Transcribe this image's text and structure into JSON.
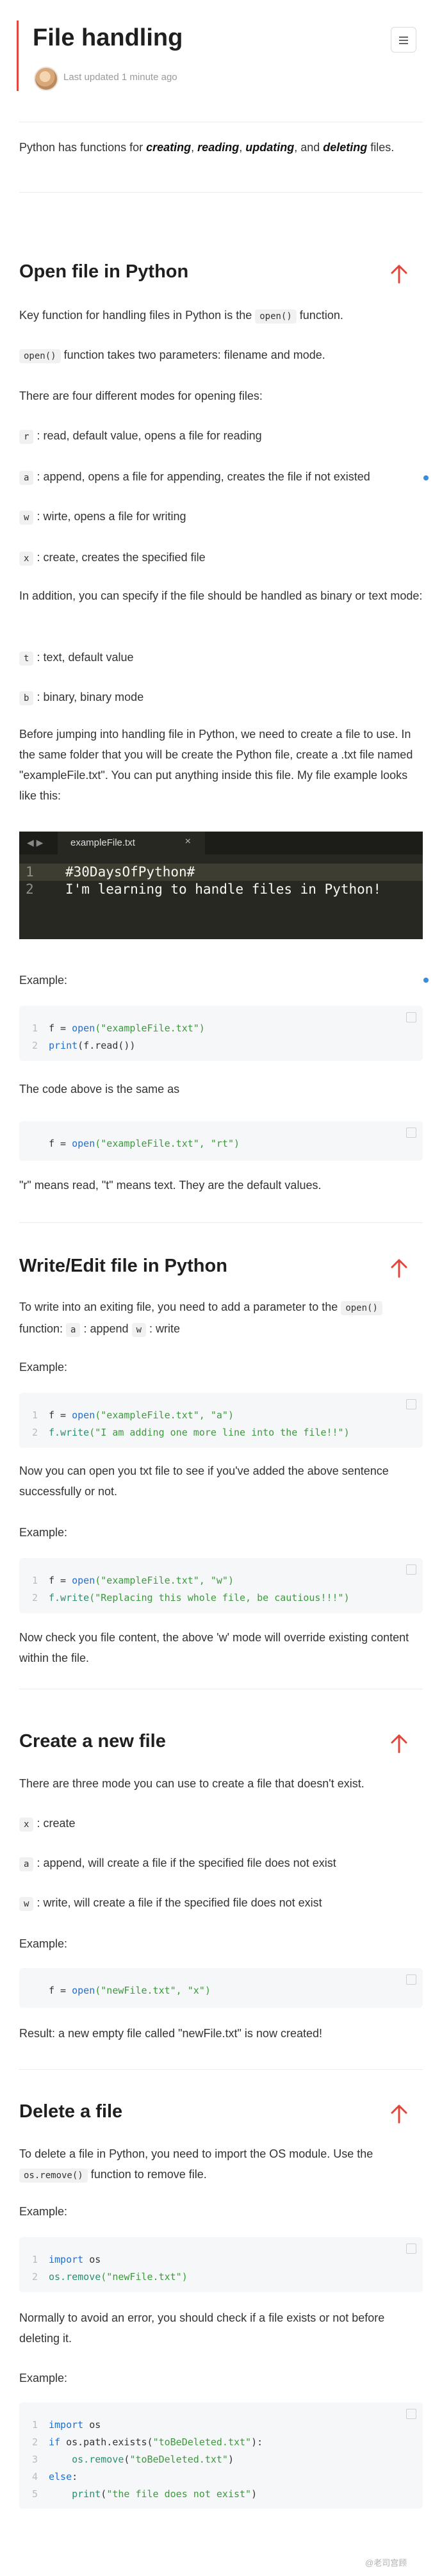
{
  "header": {
    "title": "File handling",
    "updated": "Last updated 1 minute ago"
  },
  "intro": {
    "prefix": "Python has functions for ",
    "creating": "creating",
    "comma1": ", ",
    "reading": "reading",
    "comma2": ", ",
    "updating": "updating",
    "and": ", and ",
    "deleting": "deleting",
    "suffix": " files."
  },
  "open_section": {
    "heading": "Open file in Python",
    "p1_prefix": "Key function for handling files in Python is the ",
    "p1_code": "open()",
    "p1_suffix": " function.",
    "p2_code": "open()",
    "p2_suffix": " function takes two parameters: filename and mode.",
    "p3": "There are four different modes for opening files:",
    "modes": [
      {
        "code": "r",
        "text": ": read, default value, opens a file for reading"
      },
      {
        "code": "a",
        "text": ": append, opens a file for appending, creates the file if not existed"
      },
      {
        "code": "w",
        "text": ": wirte, opens a file for writing"
      },
      {
        "code": "x",
        "text": ": create, creates the specified file"
      }
    ],
    "p4": "In addition, you can specify if the file should be handled as binary or text mode:",
    "binary_modes": [
      {
        "code": "t",
        "text": ": text, default value"
      },
      {
        "code": "b",
        "text": ": binary, binary mode"
      }
    ],
    "p5": "Before jumping into handling file in Python, we need to create a file to use. In the same folder that you will be create the Python file, create a .txt file named \"exampleFile.txt\". You can put anything inside this file. My file example looks like this:",
    "editor": {
      "nav": "◀ ▶",
      "tab": "exampleFile.txt",
      "close": "×",
      "lines": [
        "#30DaysOfPython#",
        "I'm learning to handle files in Python!"
      ],
      "line_numbers": [
        "1",
        "2"
      ]
    },
    "example_label": "Example:",
    "code1": {
      "line1_var": "f = ",
      "line1_fn": "open",
      "line1_arg": "(\"exampleFile.txt\")",
      "line2_fn": "print",
      "line2_rest": "(f.read())"
    },
    "p6": "The code above is the same as",
    "code2": {
      "var": "f = ",
      "fn": "open",
      "args": "(\"exampleFile.txt\", \"rt\")"
    },
    "p7": "\"r\" means read, \"t\" means text. They are the default values."
  },
  "write_section": {
    "heading": "Write/Edit file in Python",
    "p1_prefix": "To write into an exiting file, you need to add a parameter to the ",
    "p1_code": "open()",
    "p1_mid": " function: ",
    "code_a": "a",
    "append": " : append ",
    "code_w": "w",
    "write": " : write",
    "example_label": "Example:",
    "code1": {
      "l1_var": "f = ",
      "l1_fn": "open",
      "l1_args": "(\"exampleFile.txt\", \"a\")",
      "l2_fn": "f.write",
      "l2_args": "(\"I am adding one more line into the file!!\")"
    },
    "p2": "Now you can open you txt file to see if you've added the above sentence successfully or not.",
    "example_label2": "Example:",
    "code2": {
      "l1_var": "f = ",
      "l1_fn": "open",
      "l1_args": "(\"exampleFile.txt\", \"w\")",
      "l2_fn": "f.write",
      "l2_args": "(\"Replacing this whole file, be cautious!!!\")"
    },
    "p3": "Now check you file content, the above 'w' mode will override existing content within the file."
  },
  "create_section": {
    "heading": "Create a new file",
    "p1": "There are three mode you can use to create a file that doesn't exist.",
    "modes": [
      {
        "code": "x",
        "text": ": create"
      },
      {
        "code": "a",
        "text": ": append, will create a file if the specified file does not exist"
      },
      {
        "code": "w",
        "text": ": write, will create a file if the specified file does not exist"
      }
    ],
    "example_label": "Example:",
    "code": {
      "var": "f = ",
      "fn": "open",
      "args": "(\"newFile.txt\", \"x\")"
    },
    "result": "Result: a new empty file called \"newFile.txt\" is now created!"
  },
  "delete_section": {
    "heading": "Delete a file",
    "p1_prefix": "To delete a file in Python, you need to import the OS module. Use the ",
    "p1_code": "os.remove()",
    "p1_suffix": " function to remove file.",
    "example_label": "Example:",
    "code1": {
      "l1_kw": "import",
      "l1_rest": " os",
      "l2_fn": "os.remove",
      "l2_args": "(\"newFile.txt\")"
    },
    "p2": "Normally to avoid an error, you should check if a file exists or not before deleting it.",
    "example_label2": "Example:",
    "code2": {
      "l1_kw": "import",
      "l1_rest": " os",
      "l2_kw": "if",
      "l2_rest": " os.path.exists(",
      "l2_str": "\"toBeDeleted.txt\"",
      "l2_end": "):",
      "l3_indent": "    ",
      "l3_fn": "os.remove",
      "l3_open": "(",
      "l3_str": "\"toBeDeleted.txt\"",
      "l3_close": ")",
      "l4_kw": "else",
      "l4_colon": ":",
      "l5_indent": "    ",
      "l5_fn": "print",
      "l5_open": "(",
      "l5_str": "\"the file does not exist\"",
      "l5_close": ")"
    }
  },
  "watermark": "@老司宫顾",
  "colors": {
    "accent": "#e0463a",
    "link_dot": "#3d8bd9"
  }
}
